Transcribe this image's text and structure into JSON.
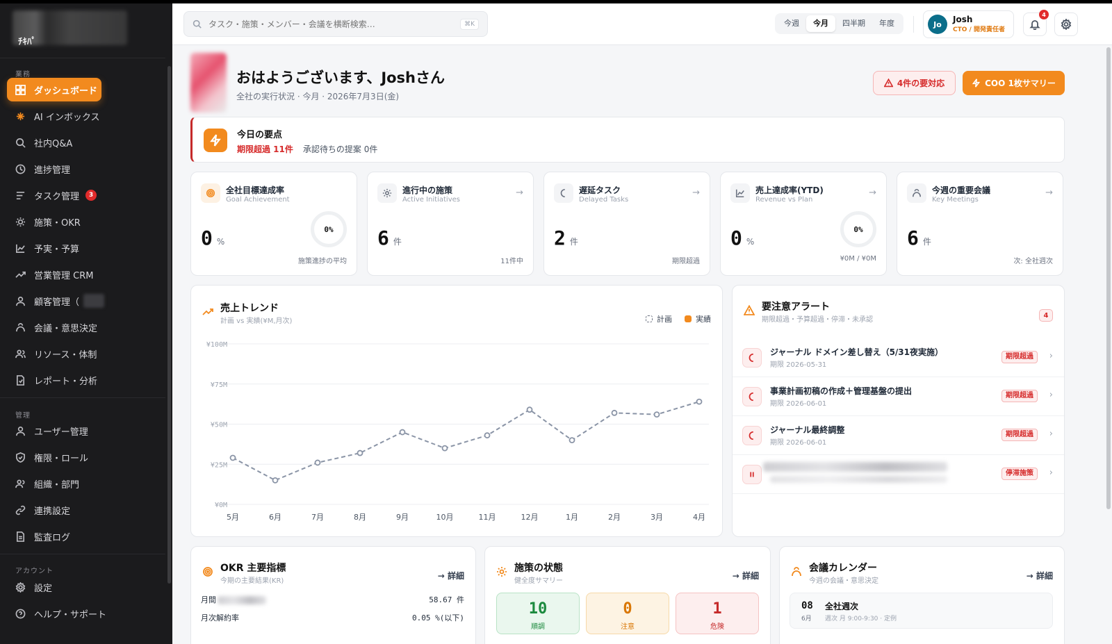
{
  "sidebar": {
    "logo_text": "ﾁｷﾊﾟ",
    "sections": {
      "business": "業務",
      "admin": "管理",
      "account": "アカウント"
    },
    "items": [
      {
        "label": "ダッシュボード",
        "icon": "dashboard-icon"
      },
      {
        "label": "AI インボックス",
        "icon": "sparkle-icon"
      },
      {
        "label": "社内Q&A",
        "icon": "search-icon"
      },
      {
        "label": "進捗管理",
        "icon": "clock-icon"
      },
      {
        "label": "タスク管理",
        "icon": "list-icon",
        "badge": "3"
      },
      {
        "label": "施策・OKR",
        "icon": "sun-icon"
      },
      {
        "label": "予実・予算",
        "icon": "chart-line-icon"
      },
      {
        "label": "営業管理 CRM",
        "icon": "trending-icon"
      },
      {
        "label": "顧客管理（",
        "icon": "user-icon"
      },
      {
        "label": "会議・意思決定",
        "icon": "meeting-icon"
      },
      {
        "label": "リソース・体制",
        "icon": "users-icon"
      },
      {
        "label": "レポート・分析",
        "icon": "report-icon"
      },
      {
        "label": "ユーザー管理",
        "icon": "user-icon"
      },
      {
        "label": "権限・ロール",
        "icon": "shield-icon"
      },
      {
        "label": "組織・部門",
        "icon": "org-icon"
      },
      {
        "label": "連携設定",
        "icon": "link-icon"
      },
      {
        "label": "監査ログ",
        "icon": "log-icon"
      },
      {
        "label": "設定",
        "icon": "gear-icon"
      },
      {
        "label": "ヘルプ・サポート",
        "icon": "help-icon"
      }
    ]
  },
  "topbar": {
    "search_placeholder": "タスク・施策・メンバー・会議を横断検索…",
    "shortcut": "⌘K",
    "periods": [
      "今週",
      "今月",
      "四半期",
      "年度"
    ],
    "active_period": "今月",
    "user": {
      "initials": "Jo",
      "name": "Josh",
      "role": "CTO / 開発責任者"
    },
    "notification_count": "4"
  },
  "greeting": {
    "title": "おはようございます、Joshさん",
    "subtitle": "全社の実行状況 · 今月 · 2026年7月3日(金)",
    "alert_button": "4件の要対応",
    "coo_button": "COO 1枚サマリー"
  },
  "key_points": {
    "title": "今日の要点",
    "overdue": "期限超過 11件",
    "pending": "承認待ちの提案 0件"
  },
  "kpis": [
    {
      "title": "全社目標達成率",
      "sub": "Goal Achievement",
      "value": "0",
      "unit": "%",
      "ring": "0%",
      "footer": "施策進捗の平均",
      "icon": "target-icon"
    },
    {
      "title": "進行中の施策",
      "sub": "Active Initiatives",
      "value": "6",
      "unit": "件",
      "footer": "11件中",
      "icon": "sun-icon"
    },
    {
      "title": "遅延タスク",
      "sub": "Delayed Tasks",
      "value": "2",
      "unit": "件",
      "footer": "期限超過",
      "icon": "moon-icon"
    },
    {
      "title": "売上達成率(YTD)",
      "sub": "Revenue vs Plan",
      "value": "0",
      "unit": "%",
      "ring": "0%",
      "footer": "¥0M / ¥0M",
      "icon": "chart-line-icon"
    },
    {
      "title": "今週の重要会議",
      "sub": "Key Meetings",
      "value": "6",
      "unit": "件",
      "footer": "次: 全社週次",
      "icon": "meeting-icon"
    }
  ],
  "trend": {
    "title": "売上トレンド",
    "subtitle": "計画 vs 実績(¥M,月次)",
    "legend_plan": "計画",
    "legend_actual": "実績"
  },
  "chart_data": {
    "type": "line",
    "categories": [
      "5月",
      "6月",
      "7月",
      "8月",
      "9月",
      "10月",
      "11月",
      "12月",
      "1月",
      "2月",
      "3月",
      "4月"
    ],
    "series": [
      {
        "name": "計画",
        "values": [
          29,
          15,
          26,
          32,
          45,
          35,
          43,
          59,
          40,
          57,
          56,
          64
        ]
      }
    ],
    "yticks": [
      "¥0M",
      "¥25M",
      "¥50M",
      "¥75M",
      "¥100M"
    ],
    "ylim": [
      0,
      100
    ],
    "grid": true,
    "legend_position": "top-right"
  },
  "alerts": {
    "title": "要注意アラート",
    "subtitle": "期限超過・予算超過・停滞・未承認",
    "count": "4",
    "items": [
      {
        "title": "ジャーナル ドメイン差し替え（5/31夜実施）",
        "date": "期限 2026-05-31",
        "tag": "期限超過"
      },
      {
        "title": "事業計画初稿の作成＋管理基盤の提出",
        "date": "期限 2026-06-01",
        "tag": "期限超過"
      },
      {
        "title": "ジャーナル最終調整",
        "date": "期限 2026-06-01",
        "tag": "期限超過"
      },
      {
        "title": "",
        "date": "",
        "tag": "停滞施策"
      }
    ]
  },
  "okr": {
    "title": "OKR 主要指標",
    "subtitle": "今期の主要結果(KR)",
    "detail": "詳細",
    "rows": [
      {
        "label": "月間",
        "value": "58.67 件"
      },
      {
        "label": "月次解約率",
        "value": "0.05 %(以下)"
      }
    ]
  },
  "status": {
    "title": "施策の状態",
    "subtitle": "健全度サマリー",
    "detail": "詳細",
    "boxes": [
      {
        "value": "10",
        "label": "順調"
      },
      {
        "value": "0",
        "label": "注意"
      },
      {
        "value": "1",
        "label": "危険"
      }
    ]
  },
  "calendar": {
    "title": "会議カレンダー",
    "subtitle": "今週の会議・意思決定",
    "detail": "詳細",
    "item": {
      "day": "08",
      "month": "6月",
      "title": "全社週次",
      "meta": "週次 月 9:00-9:30 · 定例"
    }
  }
}
